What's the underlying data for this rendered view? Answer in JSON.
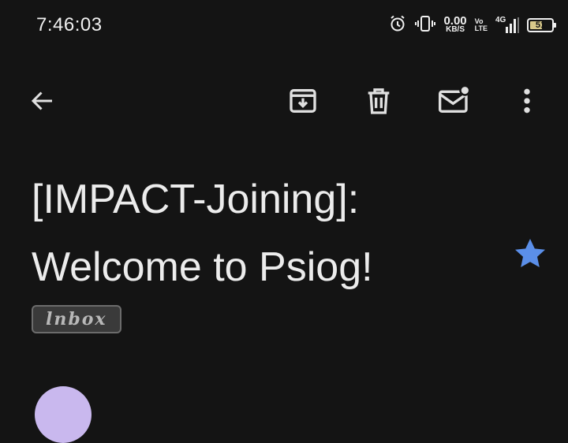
{
  "status_bar": {
    "time": "7:46:03",
    "net_speed_value": "0.00",
    "net_speed_unit": "KB/S",
    "volte_top": "Vo",
    "volte_bottom": "LTE",
    "network_type": "4G",
    "battery_level": "51"
  },
  "toolbar": {
    "back": "arrow-back-icon",
    "archive": "archive-icon",
    "delete": "trash-icon",
    "mark_unread": "mark-unread-icon",
    "more": "more-vert-icon"
  },
  "email": {
    "subject_line1": "[IMPACT-Joining]:",
    "subject_line2": "Welcome to Psiog!",
    "starred": true,
    "label": "lnbox"
  },
  "colors": {
    "background": "#141414",
    "star": "#5b8fe9",
    "avatar": "#c9b8ee"
  }
}
